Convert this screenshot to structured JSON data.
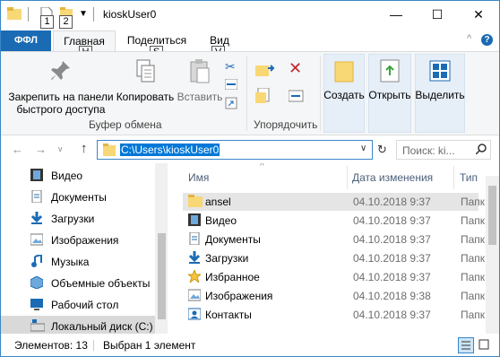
{
  "title_bar": {
    "title": "kioskUser0",
    "qat_badges": [
      "1",
      "2"
    ],
    "minimize": "—",
    "maximize": "☐",
    "close": "✕"
  },
  "ribbon_tabs": {
    "file": "ФФЛ",
    "home": "Главная",
    "share": "Поделиться",
    "view": "Вид",
    "badges": {
      "home": "H",
      "share": "S",
      "view": "V"
    },
    "collapse": "^",
    "help": "?"
  },
  "ribbon": {
    "pin": "Закрепить на панели быстрого доступа",
    "copy": "Копировать",
    "paste": "Вставить",
    "clipboard_group": "Буфер обмена",
    "organize_group": "Упорядочить",
    "new": "Создать",
    "open": "Открыть",
    "select": "Выделить"
  },
  "address": {
    "path": "C:\\Users\\kioskUser0",
    "search_placeholder": "Поиск: ki...",
    "back": "←",
    "forward": "→",
    "dropdown": "v",
    "up": "↑",
    "refresh": "↻"
  },
  "nav_items": [
    {
      "label": "Видео",
      "icon": "video-folder-icon"
    },
    {
      "label": "Документы",
      "icon": "documents-folder-icon"
    },
    {
      "label": "Загрузки",
      "icon": "downloads-folder-icon"
    },
    {
      "label": "Изображения",
      "icon": "pictures-folder-icon"
    },
    {
      "label": "Музыка",
      "icon": "music-folder-icon"
    },
    {
      "label": "Объемные объекты",
      "icon": "3d-objects-icon"
    },
    {
      "label": "Рабочий стол",
      "icon": "desktop-folder-icon"
    },
    {
      "label": "Локальный диск (C:)",
      "icon": "local-disk-icon"
    }
  ],
  "columns": {
    "name": "Имя",
    "date": "Дата изменения",
    "type": "Тип"
  },
  "files": [
    {
      "name": "ansel",
      "date": "04.10.2018 9:37",
      "type": "Папк",
      "icon": "folder-icon"
    },
    {
      "name": "Видео",
      "date": "04.10.2018 9:37",
      "type": "Папк",
      "icon": "video-folder-icon"
    },
    {
      "name": "Документы",
      "date": "04.10.2018 9:37",
      "type": "Папк",
      "icon": "documents-folder-icon"
    },
    {
      "name": "Загрузки",
      "date": "04.10.2018 9:37",
      "type": "Папк",
      "icon": "downloads-folder-icon"
    },
    {
      "name": "Избранное",
      "date": "04.10.2018 9:37",
      "type": "Папк",
      "icon": "favorites-folder-icon"
    },
    {
      "name": "Изображения",
      "date": "04.10.2018 9:38",
      "type": "Папк",
      "icon": "pictures-folder-icon"
    },
    {
      "name": "Контакты",
      "date": "04.10.2018 9:37",
      "type": "Папк",
      "icon": "contacts-folder-icon"
    }
  ],
  "status": {
    "items": "Элементов: 13",
    "selected": "Выбран 1 элемент"
  },
  "colors": {
    "accent": "#0078d7",
    "file_tab": "#1a6bb4",
    "folder": "#f8d775",
    "selection": "#e5e5e5"
  }
}
